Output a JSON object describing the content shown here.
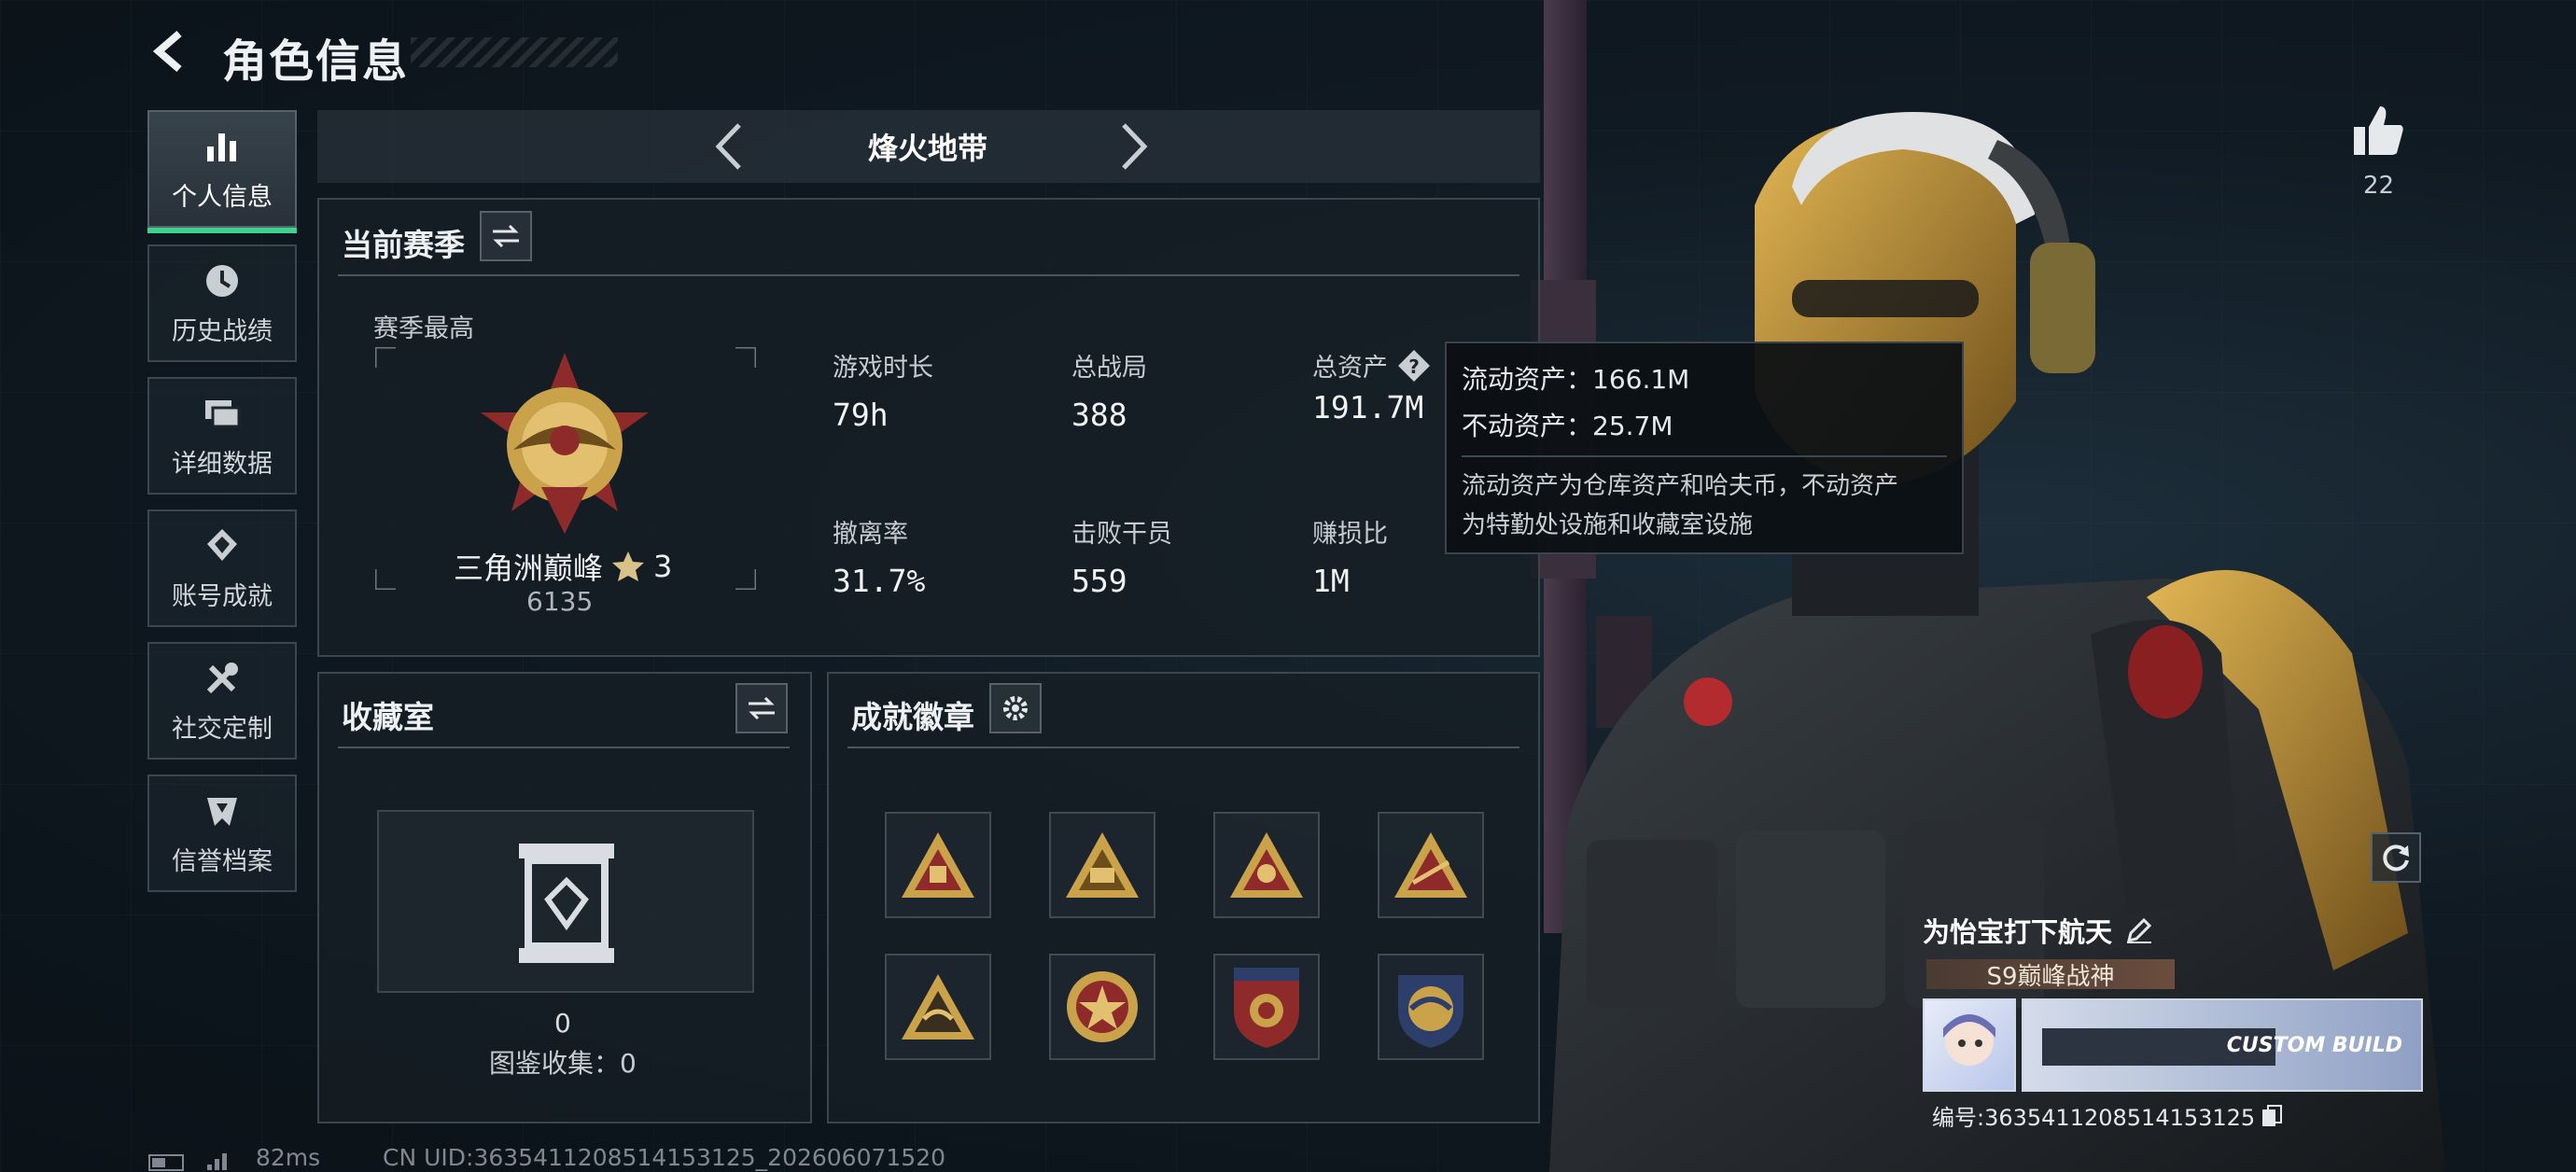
{
  "header": {
    "title": "角色信息"
  },
  "sidebar": {
    "items": [
      {
        "label": "个人信息",
        "icon": "bar-chart-icon",
        "active": true
      },
      {
        "label": "历史战绩",
        "icon": "clock-icon",
        "active": false
      },
      {
        "label": "详细数据",
        "icon": "cards-icon",
        "active": false
      },
      {
        "label": "账号成就",
        "icon": "badge-icon",
        "active": false
      },
      {
        "label": "社交定制",
        "icon": "tools-icon",
        "active": false
      },
      {
        "label": "信誉档案",
        "icon": "shield-icon",
        "active": false
      }
    ]
  },
  "mode": {
    "name": "烽火地带"
  },
  "season": {
    "title": "当前赛季",
    "best_label": "赛季最高",
    "rank_name": "三角洲巅峰",
    "rank_stars": "3",
    "rank_score": "6135",
    "stats": [
      {
        "label": "游戏时长",
        "value": "79h"
      },
      {
        "label": "总战局",
        "value": "388"
      },
      {
        "label": "总资产",
        "value": "191.7M"
      },
      {
        "label": "撤离率",
        "value": "31.7%"
      },
      {
        "label": "击败干员",
        "value": "559"
      },
      {
        "label": "赚损比",
        "value": "1M"
      }
    ]
  },
  "tooltip": {
    "liquid": "流动资产：166.1M",
    "fixed": "不动资产：25.7M",
    "desc_line1": "流动资产为仓库资产和哈夫币，不动资产",
    "desc_line2": "为特勤处设施和收藏室设施"
  },
  "collection": {
    "title": "收藏室",
    "count": "0",
    "catalog": "图鉴收集：0"
  },
  "achievements": {
    "title": "成就徽章",
    "badges": [
      "triangle-badge-icon",
      "triangle-s9-badge-icon",
      "triangle-skull-badge-icon",
      "triangle-gun-badge-icon",
      "triangle-wing-badge-icon",
      "round-star-badge-icon",
      "shield-stars-badge-icon",
      "shield-eagle-badge-icon"
    ]
  },
  "profile": {
    "likes": "22",
    "nickname": "为怡宝打下航天",
    "title_tag": "S9巅峰战神",
    "id_line": "编号:3635411208514153125",
    "card_text": "CUSTOM BUILD"
  },
  "footer": {
    "ping": "82ms",
    "uid": "CN UID:3635411208514153125_202606071520"
  },
  "colors": {
    "accent_green": "#3fd28d",
    "gold": "#c9a24a",
    "badge_red": "#8e2a2a"
  }
}
